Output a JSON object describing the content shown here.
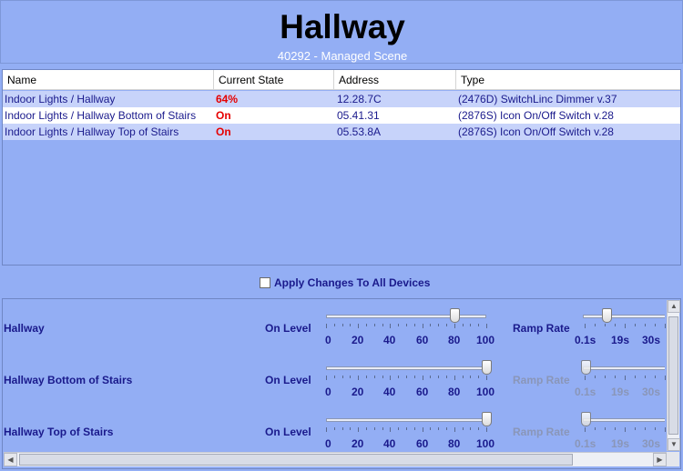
{
  "scene": {
    "title": "Hallway",
    "subtitle": "40292 - Managed Scene"
  },
  "table": {
    "columns": [
      "Name",
      "Current State",
      "Address",
      "Type"
    ],
    "rows": [
      {
        "name": "Indoor Lights / Hallway",
        "state": "64%",
        "address": "12.28.7C",
        "type": "(2476D) SwitchLinc Dimmer v.37"
      },
      {
        "name": "Indoor Lights / Hallway Bottom of Stairs",
        "state": "On",
        "address": "05.41.31",
        "type": "(2876S) Icon On/Off Switch v.28"
      },
      {
        "name": "Indoor Lights / Hallway Top of Stairs",
        "state": "On",
        "address": "05.53.8A",
        "type": "(2876S) Icon On/Off Switch v.28"
      }
    ]
  },
  "apply_all": {
    "label": "Apply Changes To All Devices",
    "checked": false
  },
  "devices": [
    {
      "name": "Hallway",
      "on_level_label": "On Level",
      "on_level": 80,
      "ramp_label": "Ramp Rate",
      "ramp_enabled": true,
      "ramp_position": 0.38
    },
    {
      "name": "Hallway Bottom of Stairs",
      "on_level_label": "On Level",
      "on_level": 100,
      "ramp_label": "Ramp Rate",
      "ramp_enabled": false,
      "ramp_position": 0.0
    },
    {
      "name": "Hallway Top of Stairs",
      "on_level_label": "On Level",
      "on_level": 100,
      "ramp_label": "Ramp Rate",
      "ramp_enabled": false,
      "ramp_position": 0.0
    }
  ],
  "on_level_scale": [
    "0",
    "20",
    "40",
    "60",
    "80",
    "100"
  ],
  "ramp_scale": [
    "0.1s",
    "19s",
    "30s"
  ],
  "colors": {
    "background": "#93AEF4",
    "state_text": "#e60000",
    "label_text": "#1a1a8c"
  }
}
